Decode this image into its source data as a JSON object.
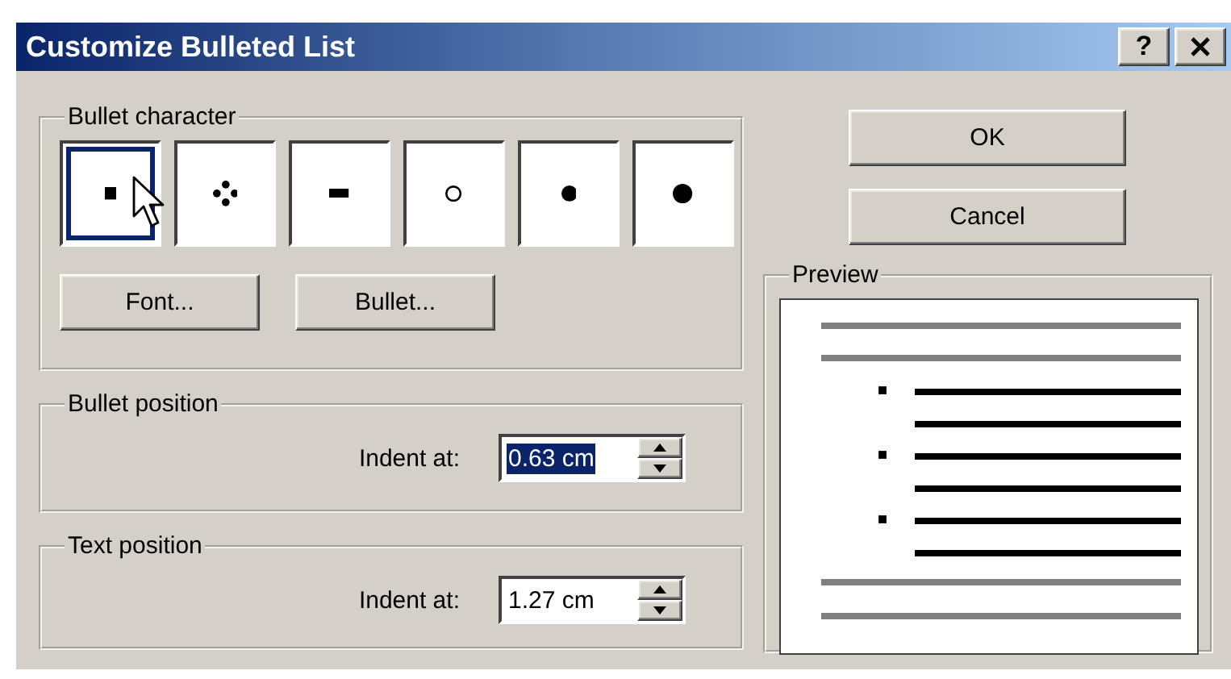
{
  "window": {
    "title": "Customize Bulleted List",
    "help_button": "?"
  },
  "bullet_character": {
    "label": "Bullet character",
    "bullets": [
      {
        "kind": "square",
        "selected": true
      },
      {
        "kind": "dots",
        "selected": false
      },
      {
        "kind": "dash",
        "selected": false
      },
      {
        "kind": "circle",
        "selected": false
      },
      {
        "kind": "dot",
        "selected": false
      },
      {
        "kind": "large-dot",
        "selected": false
      }
    ],
    "buttons": [
      "Font...",
      "Bullet..."
    ]
  },
  "bullet_position": {
    "label": "Bullet position",
    "field_label": "Indent at:",
    "value": "0.63 cm",
    "selected": true
  },
  "text_position": {
    "label": "Text position",
    "field_label": "Indent at:",
    "value": "1.27 cm",
    "selected": false
  },
  "buttons": [
    "OK",
    "Cancel"
  ],
  "preview": {
    "label": "Preview"
  }
}
